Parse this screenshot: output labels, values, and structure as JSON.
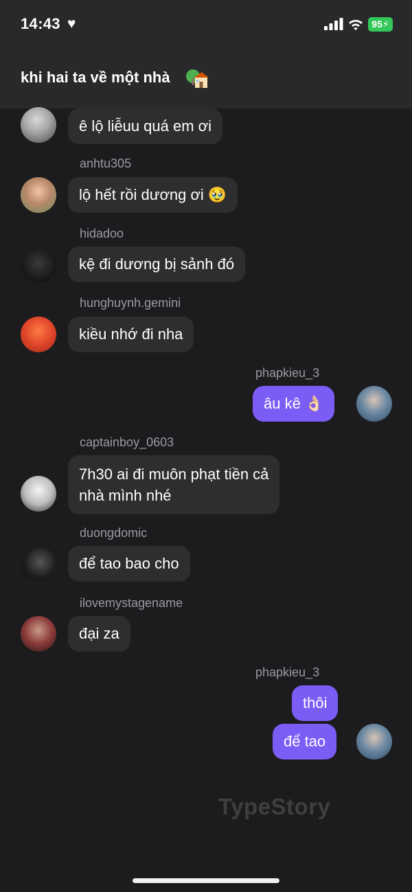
{
  "status_bar": {
    "time": "14:43",
    "battery": "95"
  },
  "header": {
    "title": "khi hai ta về một nhà"
  },
  "messages": [
    {
      "user": "",
      "text": "ê lộ liễuu quá em ơi"
    },
    {
      "user": "anhtu305",
      "text": "lộ hết rồi dương ơi 🥹"
    },
    {
      "user": "hidadoo",
      "text": "kệ đi dương bị sảnh đó"
    },
    {
      "user": "hunghuynh.gemini",
      "text": "kiều nhớ đi nha"
    },
    {
      "user": "phapkieu_3",
      "text": "âu kê 👌🏻"
    },
    {
      "user": "captainboy_0603",
      "text_line1": "7h30 ai đi muôn phạt tiền cả",
      "text_line2": "nhà mình nhé"
    },
    {
      "user": "duongdomic",
      "text": "để tao bao cho"
    },
    {
      "user": "ilovemystagename",
      "text": "đại za"
    },
    {
      "user": "phapkieu_3",
      "text": "thôi",
      "text2": "để tao"
    }
  ],
  "watermark": "TypeStory",
  "colors": {
    "background": "#1c1c1e",
    "header": "#29292b",
    "incoming_bubble": "#2e2e30",
    "outgoing_bubble": "#7b5cf5",
    "username": "#9b9ba0",
    "battery": "#34c759"
  }
}
